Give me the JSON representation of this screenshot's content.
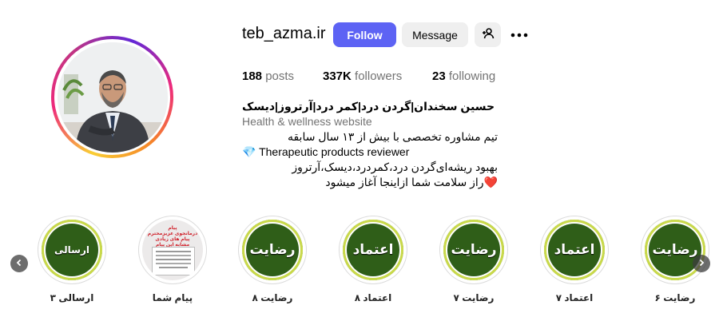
{
  "profile": {
    "username": "teb_azma.ir",
    "follow_label": "Follow",
    "message_label": "Message",
    "posts_count": "188",
    "posts_label": "posts",
    "followers_count": "337K",
    "followers_label": "followers",
    "following_count": "23",
    "following_label": "following"
  },
  "bio": {
    "name": "حسین سخندان|گردن درد|کمر درد|آرتروز|دیسک",
    "category": "Health & wellness website",
    "lines": [
      "تیم مشاوره تخصصی با بیش از ۱۳ سال سابقه",
      "💎 Therapeutic products reviewer",
      "بهبود ریشه‌ای‌گردن درد،کمردرد،دیسک،آرتروز",
      "❤️راز سلامت شما ازاینجا آغاز میشود"
    ]
  },
  "highlights": [
    {
      "cover_text": "ارسالی",
      "label": "ارسالی ۳",
      "style": "green-small"
    },
    {
      "cover_text": "",
      "label": "پیام شما",
      "style": "document",
      "doc_title": "پیام",
      "doc_subtitle": "درمانجوی عزیزمحترم",
      "doc_red": "پیام های زیادی مشابه این پیام ارسال شده"
    },
    {
      "cover_text": "رضایت",
      "label": "رضایت ۸",
      "style": "green"
    },
    {
      "cover_text": "اعتماد",
      "label": "اعتماد ۸",
      "style": "green"
    },
    {
      "cover_text": "رضایت",
      "label": "رضایت ۷",
      "style": "green"
    },
    {
      "cover_text": "اعتماد",
      "label": "اعتماد ۷",
      "style": "green"
    },
    {
      "cover_text": "رضایت",
      "label": "رضایت ۶",
      "style": "green"
    }
  ],
  "colors": {
    "follow_button": "#5d63f4",
    "secondary_button": "#efefef",
    "highlight_green": "#2f5e18",
    "muted_text": "#737373"
  },
  "icons": {
    "suggest": "person-plus-icon",
    "more": "more-horizontal-icon",
    "prev": "chevron-left-icon",
    "next": "chevron-right-icon"
  }
}
